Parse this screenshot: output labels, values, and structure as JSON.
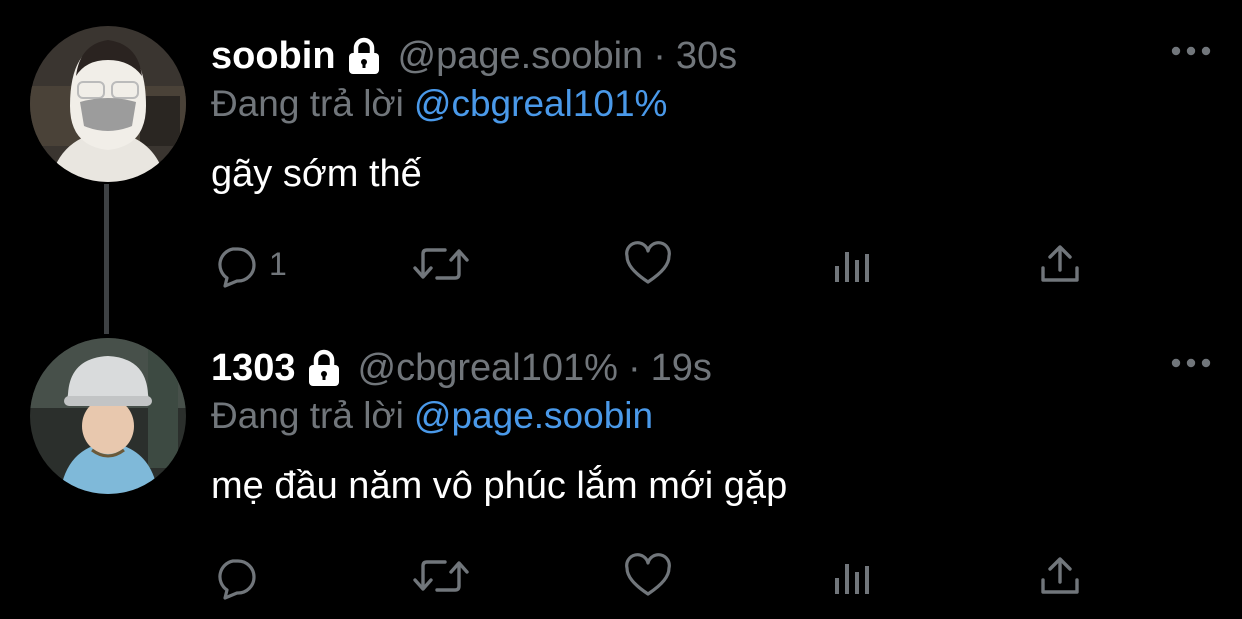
{
  "tweets": [
    {
      "display_name": "soobin",
      "handle": "@page.soobin",
      "separator": "·",
      "time": "30s",
      "reply_prefix": "Đang trả lời",
      "reply_to": "@cbgreal101%",
      "text": "gãy sớm thế",
      "reply_count": "1",
      "protected": true
    },
    {
      "display_name": "1303",
      "handle": "@cbgreal101%",
      "separator": "·",
      "time": "19s",
      "reply_prefix": "Đang trả lời",
      "reply_to": "@page.soobin",
      "text": "mẹ đầu năm vô phúc lắm mới gặp",
      "reply_count": "",
      "protected": true
    }
  ],
  "colors": {
    "background": "#000000",
    "primary_text": "#ffffff",
    "secondary_text": "#71767b",
    "link": "#4a99e9",
    "thread_line": "#3e4144"
  },
  "icons": {
    "lock": "lock-icon",
    "more": "more-icon",
    "reply": "reply-icon",
    "retweet": "retweet-icon",
    "like": "heart-icon",
    "views": "views-icon",
    "share": "share-icon"
  }
}
